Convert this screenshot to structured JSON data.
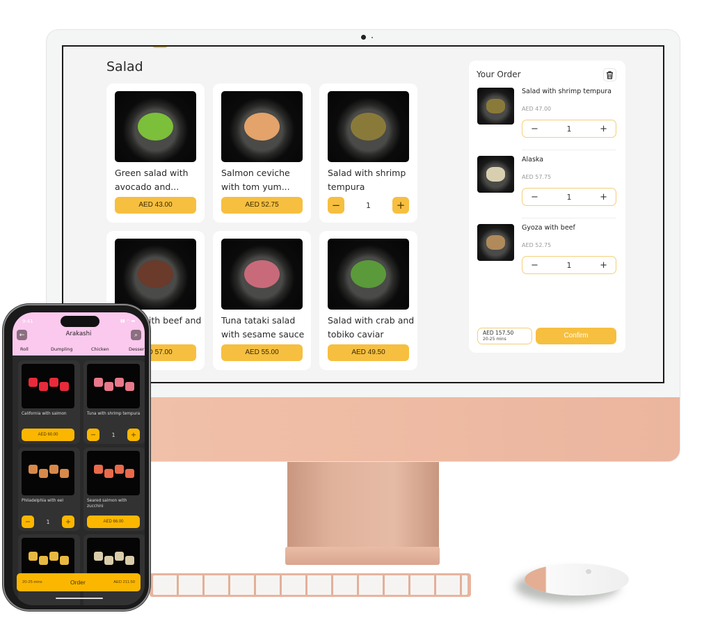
{
  "desktop": {
    "section_title": "Salad",
    "products": [
      {
        "name": "Green salad with avocado and...",
        "price": "AED 43.00",
        "in_cart": false,
        "color": "#7cbf3a"
      },
      {
        "name": "Salmon ceviche with tom yum...",
        "price": "AED 52.75",
        "in_cart": false,
        "color": "#e3a36a"
      },
      {
        "name": "Salad with shrimp tempura",
        "price": "AED 47.00",
        "in_cart": true,
        "quantity": "1",
        "color": "#8a7a3a"
      },
      {
        "name": "Salad with beef and truffle...",
        "visible_name": "...ith beef ...d truffle...",
        "price": "AED 57.00",
        "in_cart": false,
        "color": "#6a3a2a"
      },
      {
        "name": "Tuna tataki salad with sesame sauce",
        "price": "AED 55.00",
        "in_cart": false,
        "color": "#c86a7a"
      },
      {
        "name": "Salad with crab and tobiko caviar",
        "price": "AED 49.50",
        "in_cart": false,
        "color": "#5a9a3a"
      }
    ],
    "order": {
      "title": "Your Order",
      "clear_icon": "trash-icon",
      "items": [
        {
          "name": "Salad with shrimp tempura",
          "price": "AED 47.00",
          "quantity": "1",
          "color": "#8a7a3a"
        },
        {
          "name": "Alaska",
          "price": "AED 57.75",
          "quantity": "1",
          "color": "#d8cfb0"
        },
        {
          "name": "Gyoza with beef",
          "price": "AED 52.75",
          "quantity": "1",
          "color": "#b08a5a"
        }
      ],
      "total": "AED 157.50",
      "eta": "20-25 mins",
      "confirm_label": "Confirm"
    },
    "minus_glyph": "−",
    "plus_glyph": "+"
  },
  "phone": {
    "status_time": "9:41",
    "status_icons": "▮▮ ◠ ▬",
    "title": "Arakashi",
    "back_icon": "←",
    "search_icon": "⌕",
    "tabs": [
      "Roll",
      "Dumpling",
      "Chicken",
      "Desser"
    ],
    "products": [
      {
        "name": "California with salmon",
        "price": "AED 60.00",
        "in_cart": false,
        "color": "#e82a3a"
      },
      {
        "name": "Tuna with shrimp tempura",
        "in_cart": true,
        "quantity": "1",
        "color": "#e8788a"
      },
      {
        "name": "Philadelphia with eel",
        "in_cart": true,
        "quantity": "1",
        "color": "#d8894a"
      },
      {
        "name": "Seared salmon with zucchini",
        "price": "AED 66.00",
        "in_cart": false,
        "color": "#e86a4a"
      },
      {
        "name": "",
        "color": "#e8b840"
      },
      {
        "name": "",
        "color": "#d8ccaa"
      }
    ],
    "order_bar": {
      "eta": "20-25 mins",
      "label": "Order",
      "total": "AED 211.50"
    }
  },
  "colors": {
    "accent": "#f6bf40",
    "phone_accent": "#fbb700",
    "phone_header": "#fbc8ee",
    "device_body": "#f2c2aa"
  }
}
